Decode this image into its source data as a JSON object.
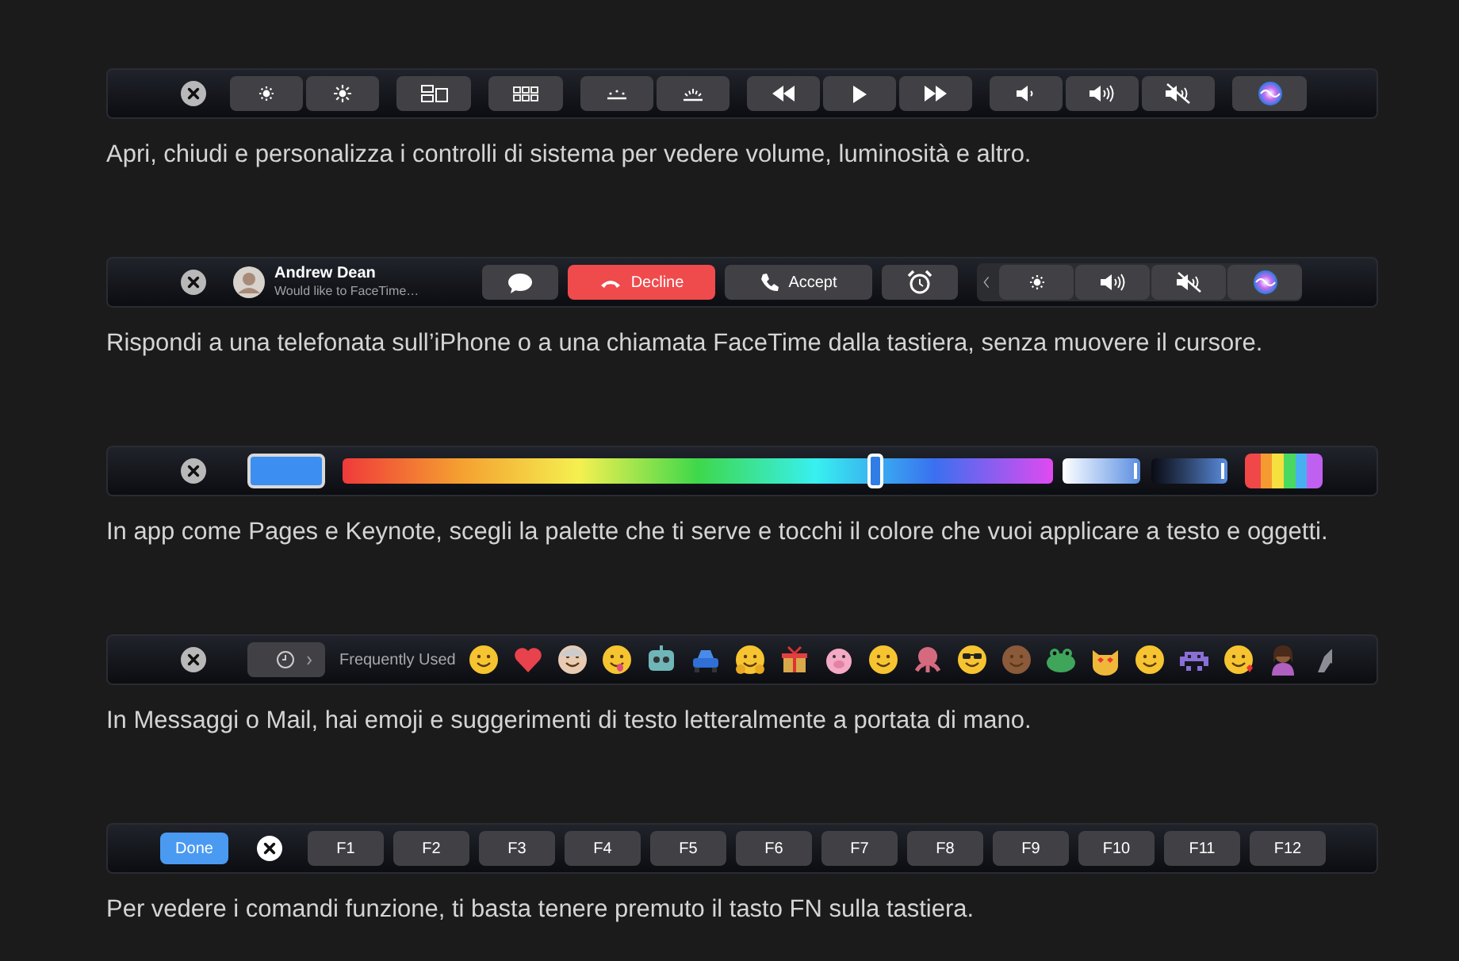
{
  "sections": [
    {
      "kind": "system",
      "caption": "Apri, chiudi e personalizza i controlli di sistema per vedere volume, luminosità e altro."
    },
    {
      "kind": "call",
      "caller": "Andrew Dean",
      "subtitle": "Would like to FaceTime…",
      "decline": "Decline",
      "accept": "Accept",
      "caption": "Rispondi a una telefonata sull’iPhone o a una chiamata FaceTime dalla tastiera, senza muovere il cursore."
    },
    {
      "kind": "color",
      "hue": {
        "level": 0.75
      },
      "saturation": {
        "level": 0.94
      },
      "brightness": {
        "level": 0.94
      },
      "caption": "In app come Pages e Keynote, scegli la palette che ti serve e tocchi il colore che vuoi applicare a testo e oggetti."
    },
    {
      "kind": "emoji",
      "category": "Frequently Used",
      "caption": "In Messaggi o Mail, hai emoji e suggerimenti di testo letteralmente a portata di mano."
    },
    {
      "kind": "function",
      "done": "Done",
      "keys": [
        "F1",
        "F2",
        "F3",
        "F4",
        "F5",
        "F6",
        "F7",
        "F8",
        "F9",
        "F10",
        "F11",
        "F12"
      ],
      "caption": "Per vedere i comandi funzione, ti basta tenere premuto il tasto FN sulla tastiera."
    }
  ]
}
